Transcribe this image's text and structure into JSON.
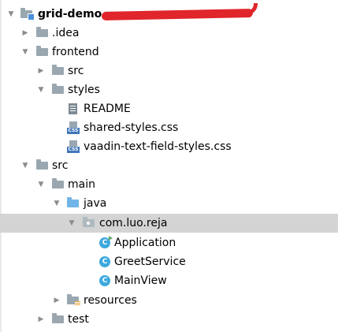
{
  "tree": {
    "root": {
      "label": "grid-demo",
      "expanded": true
    },
    "idea": {
      "label": ".idea",
      "expanded": false
    },
    "frontend": {
      "label": "frontend",
      "expanded": true
    },
    "frontend_src": {
      "label": "src",
      "expanded": false
    },
    "styles": {
      "label": "styles",
      "expanded": true
    },
    "readme": {
      "label": "README"
    },
    "shared_styles": {
      "label": "shared-styles.css",
      "icon_tag": "CSS"
    },
    "vaadin_styles": {
      "label": "vaadin-text-field-styles.css",
      "icon_tag": "CSS"
    },
    "src": {
      "label": "src",
      "expanded": true
    },
    "main": {
      "label": "main",
      "expanded": true
    },
    "java": {
      "label": "java",
      "expanded": true
    },
    "package": {
      "label": "com.luo.reja",
      "expanded": true,
      "selected": true
    },
    "application": {
      "label": "Application",
      "icon_letter": "C"
    },
    "greet_service": {
      "label": "GreetService",
      "icon_letter": "C"
    },
    "main_view": {
      "label": "MainView",
      "icon_letter": "C"
    },
    "resources": {
      "label": "resources",
      "expanded": false
    },
    "test": {
      "label": "test",
      "expanded": false
    }
  },
  "colors": {
    "selection": "#d4d4d4",
    "folder": "#9aa7b0",
    "source_folder": "#71b5e8",
    "class_icon": "#3da9dd",
    "css_tag": "#4076b8",
    "redaction": "#e0262b"
  }
}
